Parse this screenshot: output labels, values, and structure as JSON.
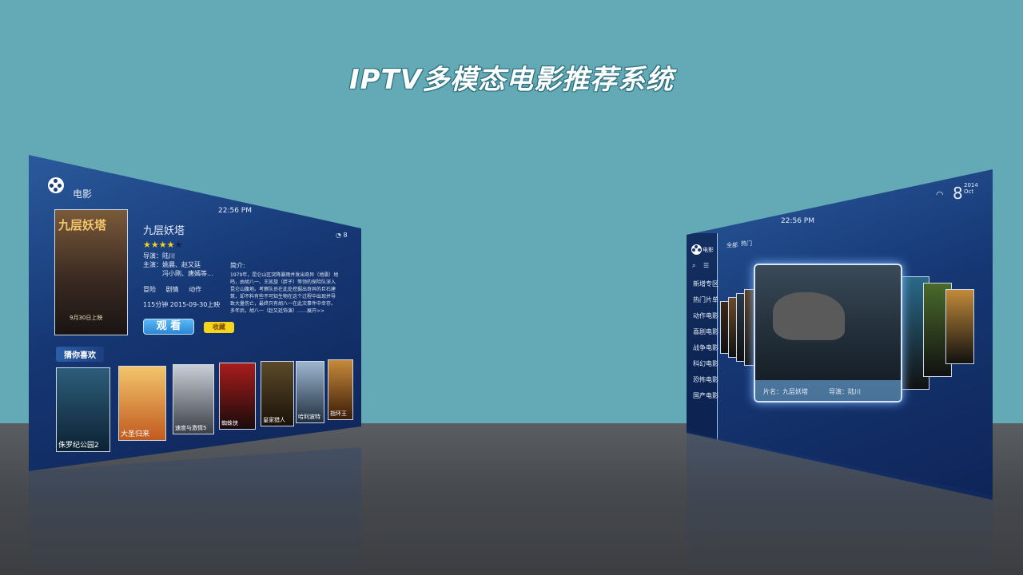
{
  "page_title": "IPTV多模态电影推荐系统",
  "colors": {
    "background": "#64aab6",
    "panel": "#163774",
    "accent": "#2b86d4",
    "fav": "#f6d41c",
    "star": "#f3d21e"
  },
  "left_screen": {
    "app_icon": "film-reel-icon",
    "app_title": "电影",
    "time": "22:56 PM",
    "status_tiny": "8",
    "movie": {
      "poster_title": "九层妖塔",
      "poster_date": "9月30日上映",
      "title": "九层妖塔",
      "rating": 4,
      "rating_max": 5,
      "director": "导演：陆川",
      "cast_line1": "主演：姚晨、赵又廷",
      "cast_line2": "冯小刚、唐嫣等...",
      "genres": [
        "冒险",
        "剧情",
        "动作"
      ],
      "meta": "115分钟  2015-09-30上映",
      "intro_label": "简介:",
      "intro_text": [
        "1979年，昆仑山区突降暴雨并发出奇异（地震）地鸣，由胡八一、王凯旋（胖子）等领的探险队深入昆仑山腹地。考察队员在此处挖掘出奇异的巨石建筑，却不料有些不可知生物在这个过程中出现并导致大量伤亡，最终只有胡八一在此次事件中幸存。多年后，胡八一（赵又廷饰演）……展开>>"
      ],
      "watch_label": "观 看",
      "fav_label": "收藏"
    },
    "recommend_label": "猜你喜欢",
    "recommendations": [
      {
        "label": "侏罗纪公园2",
        "color1": "#2d5d7a",
        "color2": "#0c2233"
      },
      {
        "label": "大圣归来",
        "color1": "#f3c56b",
        "color2": "#c15a1f"
      },
      {
        "label": "速度与激情5",
        "color1": "#c9cfd6",
        "color2": "#3b3f47"
      },
      {
        "label": "蜘蛛侠",
        "color1": "#a81c1c",
        "color2": "#1a0b0b"
      },
      {
        "label": "皇家猎人",
        "color1": "#5b4a2a",
        "color2": "#1a1208"
      },
      {
        "label": "哈利波特",
        "color1": "#9db6cf",
        "color2": "#20303f"
      },
      {
        "label": "指环王",
        "color1": "#c88a3a",
        "color2": "#3a1c08"
      }
    ]
  },
  "right_screen": {
    "time": "22:56 PM",
    "date_day": "8",
    "date_year": "2014",
    "date_month": "Oct",
    "app_title": "电影",
    "filter_tabs": [
      "全部",
      "热门"
    ],
    "sidebar_icons": [
      "search-icon",
      "list-icon"
    ],
    "menu": [
      "新增专区",
      "热门片单",
      "动作电影",
      "喜剧电影",
      "战争电影",
      "科幻电影",
      "恐怖电影",
      "国产电影"
    ],
    "featured": {
      "director_text": "导演：陆川",
      "title_text": "片名：九层妖塔"
    },
    "carousel_left_colors": [
      "#3d2a1a",
      "#6a4b2a",
      "#2a3a4a",
      "#5a3a1a"
    ],
    "carousel_right_colors": [
      "#2a6a8a",
      "#4a6a2a",
      "#c28a3a"
    ]
  }
}
